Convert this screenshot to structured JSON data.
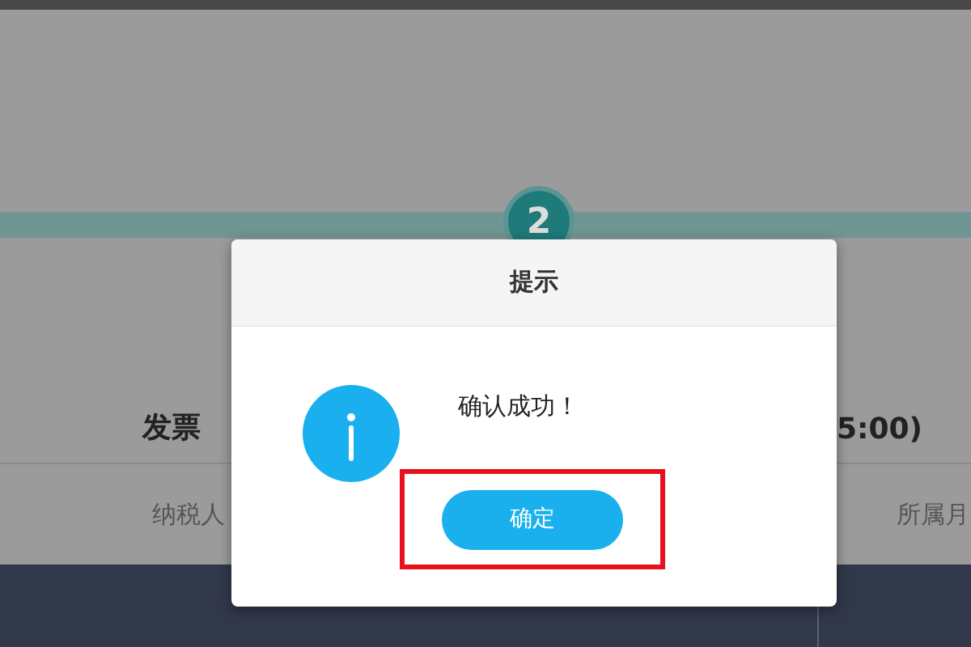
{
  "step": {
    "number": "2"
  },
  "page": {
    "title_left": "发票",
    "title_right": "5:00)",
    "columns": [
      "纳税人",
      "所属月"
    ]
  },
  "dialog": {
    "title": "提示",
    "message": "确认成功！",
    "button": {
      "label": "确定",
      "highlighted": true
    }
  }
}
